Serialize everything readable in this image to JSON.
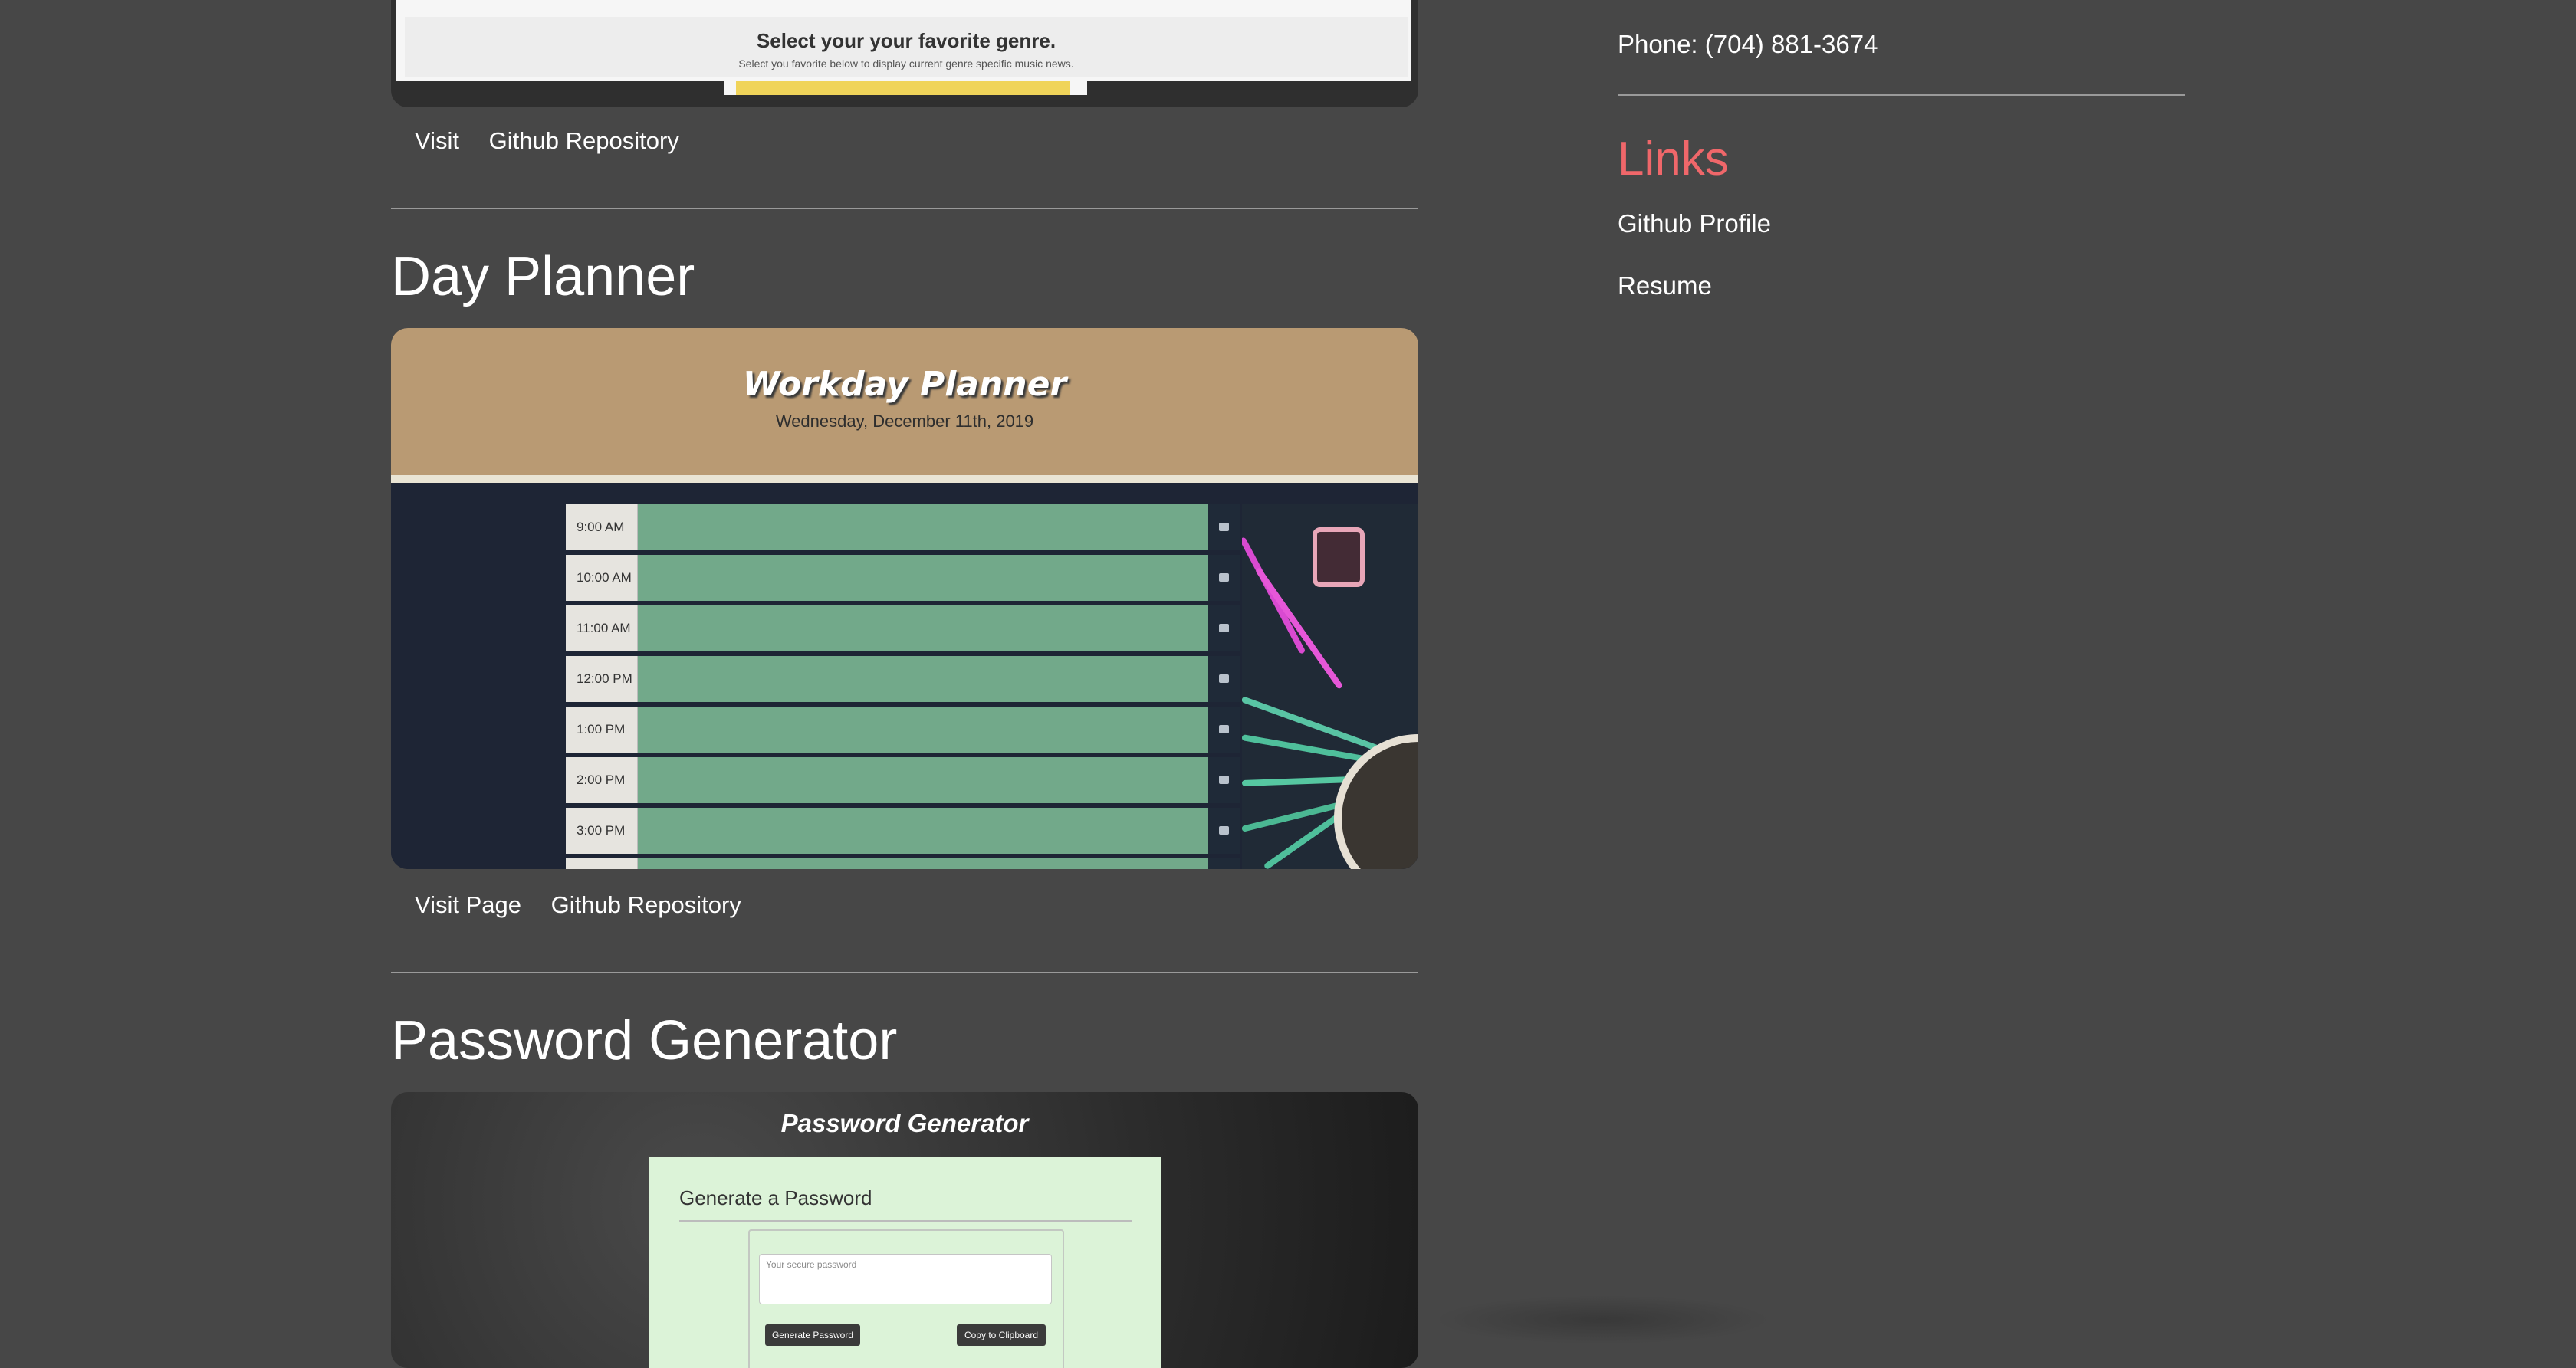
{
  "projects": {
    "genre": {
      "screenshot_title": "Select your your favorite genre.",
      "screenshot_subtitle": "Select you favorite below to display current genre specific music news.",
      "links": [
        "Visit",
        "Github Repository"
      ]
    },
    "day_planner": {
      "title": "Day Planner",
      "screenshot_title": "Workday Planner",
      "screenshot_date": "Wednesday, December 11th, 2019",
      "hours": [
        "9:00 AM",
        "10:00 AM",
        "11:00 AM",
        "12:00 PM",
        "1:00 PM",
        "2:00 PM",
        "3:00 PM"
      ],
      "links": [
        "Visit Page",
        "Github Repository"
      ]
    },
    "password_generator": {
      "title": "Password Generator",
      "screenshot_title": "Password Generator",
      "card_title": "Generate a Password",
      "placeholder": "Your secure password",
      "generate_button": "Generate Password",
      "copy_button": "Copy to Clipboard"
    }
  },
  "sidebar": {
    "phone": "Phone: (704) 881-3674",
    "links_heading": "Links",
    "links": [
      "Github Profile",
      "Resume"
    ]
  },
  "colors": {
    "background": "#474747",
    "accent": "#f0676a",
    "planner_header": "#b99a73",
    "planner_row": "#72a98a"
  }
}
